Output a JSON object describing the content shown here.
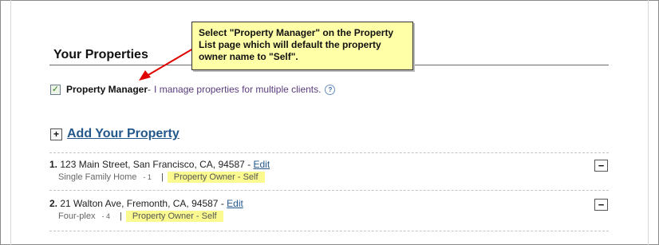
{
  "section": {
    "title": "Your Properties"
  },
  "property_manager": {
    "checked": true,
    "label": "Property Manager",
    "dash": " - ",
    "description": "I manage properties for multiple clients.",
    "help_glyph": "?"
  },
  "add_property": {
    "icon_glyph": "+",
    "label": "Add Your Property"
  },
  "callout": {
    "text": "Select \"Property Manager\" on the Property List page which will default the property owner name to \"Self\"."
  },
  "properties": [
    {
      "number": "1.",
      "address": "123 Main Street, San Francisco, CA, 94587",
      "separator": " - ",
      "edit_label": "Edit",
      "type": "Single Family Home",
      "units": "- 1",
      "pipe": "|",
      "owner": "Property Owner - Self",
      "collapse_glyph": "−"
    },
    {
      "number": "2.",
      "address": "21 Walton Ave, Fremonth, CA, 94587",
      "separator": " - ",
      "edit_label": "Edit",
      "type": "Four-plex",
      "units": "- 4",
      "pipe": "|",
      "owner": "Property Owner - Self",
      "collapse_glyph": "−"
    }
  ],
  "colors": {
    "link": "#23588c",
    "highlight": "#fafa90",
    "callout_bg": "#ffffa8",
    "arrow": "#e00000"
  }
}
